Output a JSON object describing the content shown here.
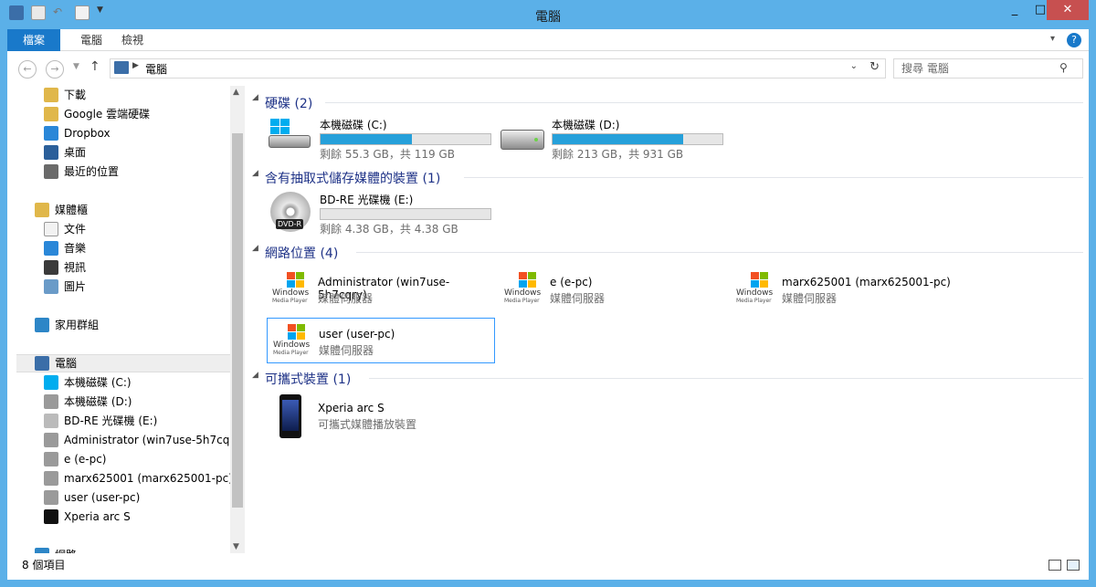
{
  "window": {
    "title": "電腦"
  },
  "ribbon": {
    "tabs": [
      "檔案",
      "電腦",
      "檢視"
    ]
  },
  "address": {
    "path": "電腦"
  },
  "search": {
    "placeholder": "搜尋 電腦"
  },
  "sidebar": {
    "items": [
      {
        "label": "下載",
        "icon": "downloads-folder-icon"
      },
      {
        "label": "Google 雲端硬碟",
        "icon": "google-drive-icon"
      },
      {
        "label": "Dropbox",
        "icon": "dropbox-icon"
      },
      {
        "label": "桌面",
        "icon": "desktop-icon"
      },
      {
        "label": "最近的位置",
        "icon": "recent-places-icon"
      },
      {
        "label": "媒體櫃",
        "icon": "library-icon"
      },
      {
        "label": "文件",
        "icon": "documents-icon"
      },
      {
        "label": "音樂",
        "icon": "music-icon"
      },
      {
        "label": "視訊",
        "icon": "videos-icon"
      },
      {
        "label": "圖片",
        "icon": "pictures-icon"
      },
      {
        "label": "家用群組",
        "icon": "homegroup-icon"
      },
      {
        "label": "電腦",
        "icon": "computer-icon"
      },
      {
        "label": "本機磁碟 (C:)",
        "icon": "windows-drive-icon"
      },
      {
        "label": "本機磁碟 (D:)",
        "icon": "hard-drive-icon"
      },
      {
        "label": "BD-RE 光碟機 (E:)",
        "icon": "disc-drive-icon"
      },
      {
        "label": "Administrator (win7use-5h7cqry)",
        "icon": "media-server-icon"
      },
      {
        "label": "e (e-pc)",
        "icon": "media-server-icon"
      },
      {
        "label": "marx625001 (marx625001-pc)",
        "icon": "media-server-icon"
      },
      {
        "label": "user (user-pc)",
        "icon": "media-server-icon"
      },
      {
        "label": "Xperia arc S",
        "icon": "phone-icon"
      },
      {
        "label": "網路",
        "icon": "network-icon"
      }
    ]
  },
  "groups": {
    "hdd": "硬碟 (2)",
    "removable": "含有抽取式儲存媒體的裝置 (1)",
    "network": "網路位置 (4)",
    "portable": "可攜式裝置 (1)"
  },
  "drives": [
    {
      "name": "本機磁碟 (C:)",
      "free": "剩餘 55.3 GB，共 119 GB",
      "used_fraction": 0.54,
      "color": "#26a0da"
    },
    {
      "name": "本機磁碟 (D:)",
      "free": "剩餘 213 GB，共 931 GB",
      "used_fraction": 0.77,
      "color": "#26a0da"
    },
    {
      "name": "BD-RE 光碟機 (E:)",
      "free": "剩餘 4.38 GB，共 4.38 GB",
      "used_fraction": 0.0,
      "color": "#26a0da"
    }
  ],
  "network_locations": [
    {
      "name": "Administrator (win7use-5h7cqry)",
      "type": "媒體伺服器"
    },
    {
      "name": "e (e-pc)",
      "type": "媒體伺服器"
    },
    {
      "name": "marx625001 (marx625001-pc)",
      "type": "媒體伺服器"
    },
    {
      "name": "user (user-pc)",
      "type": "媒體伺服器"
    }
  ],
  "wmp": {
    "line1": "Windows",
    "line2": "Media Player"
  },
  "disc_label": "DVD-R",
  "portable": [
    {
      "name": "Xperia arc S",
      "type": "可攜式媒體播放裝置"
    }
  ],
  "status": {
    "count": "8 個項目"
  }
}
